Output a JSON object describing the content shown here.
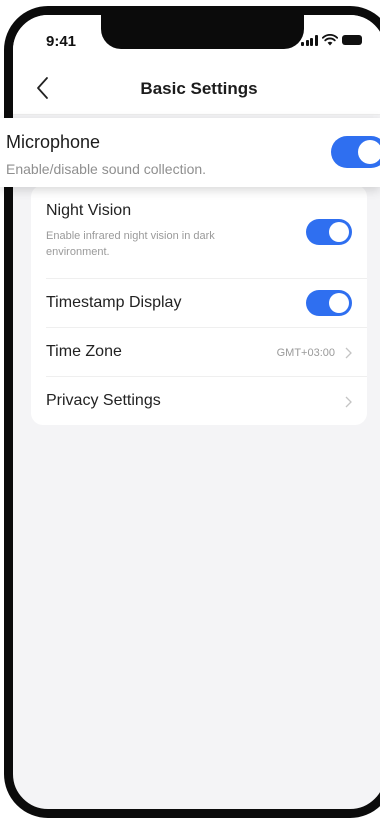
{
  "status_bar": {
    "time": "9:41"
  },
  "nav": {
    "title": "Basic Settings"
  },
  "microphone": {
    "title": "Microphone",
    "description": "Enable/disable sound collection.",
    "enabled": true
  },
  "settings": {
    "night_vision": {
      "title": "Night Vision",
      "description": "Enable infrared night vision in dark environment.",
      "enabled": true
    },
    "timestamp_display": {
      "title": "Timestamp Display",
      "enabled": true
    },
    "time_zone": {
      "title": "Time Zone",
      "value": "GMT+03:00"
    },
    "privacy_settings": {
      "title": "Privacy Settings"
    }
  },
  "colors": {
    "accent": "#2f6ff0",
    "background": "#f4f4f6",
    "frame": "#0b0b0b"
  },
  "icons": {
    "back": "chevron-left-icon",
    "row_arrow": "chevron-right-icon",
    "signal": "signal-icon",
    "wifi": "wifi-icon",
    "battery": "battery-icon"
  }
}
